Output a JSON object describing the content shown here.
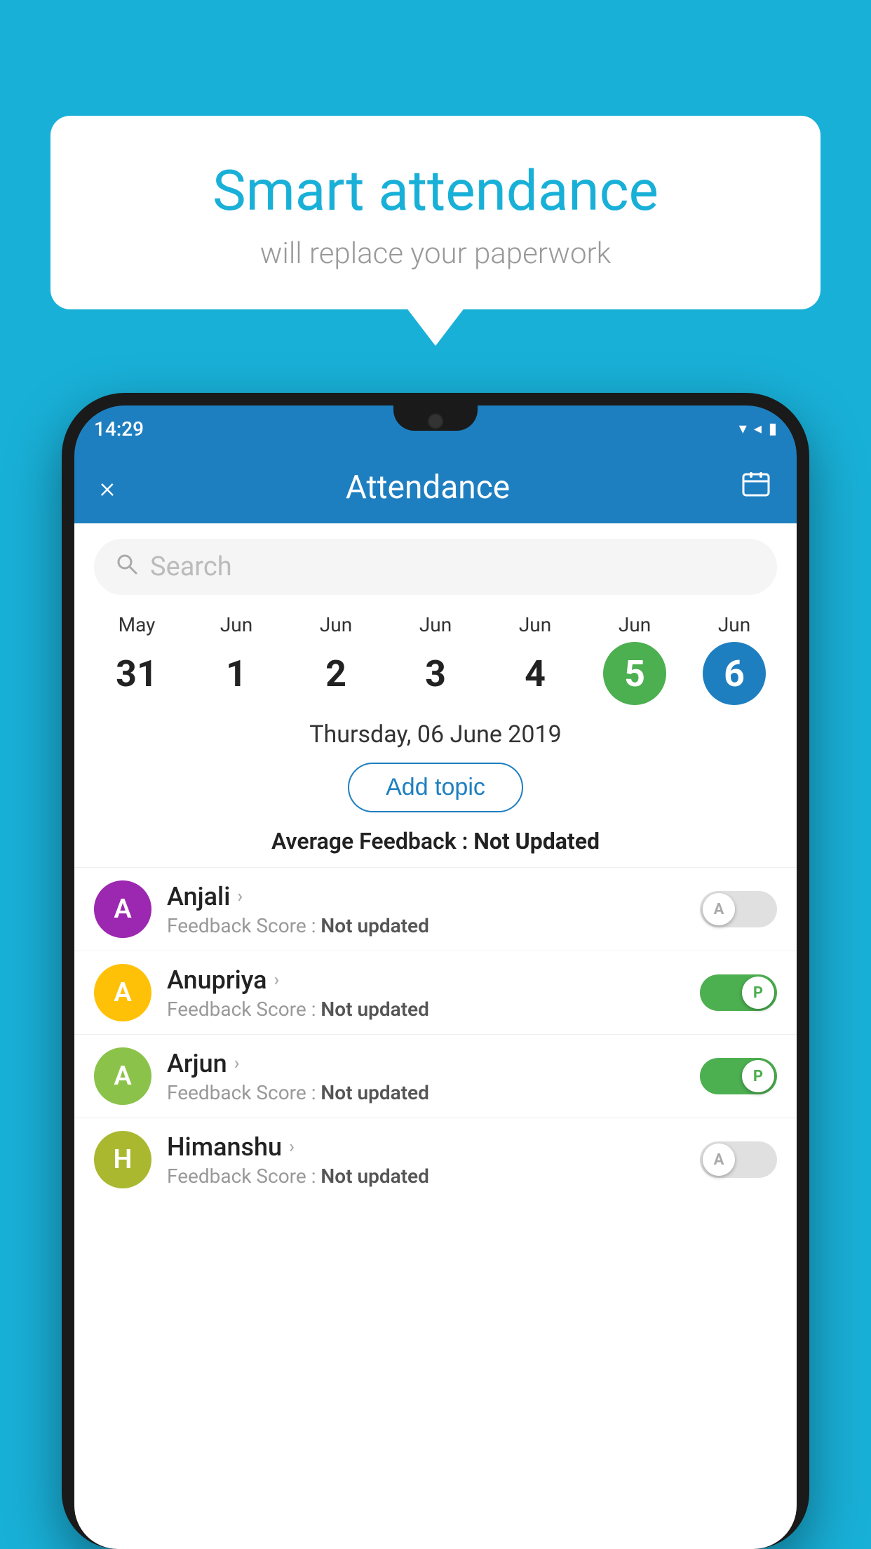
{
  "background_color": "#19b0d8",
  "bubble": {
    "title": "Smart attendance",
    "subtitle": "will replace your paperwork"
  },
  "phone": {
    "status_bar": {
      "time": "14:29",
      "wifi_icon": "wifi",
      "signal_icon": "signal",
      "battery_icon": "battery"
    },
    "header": {
      "close_icon": "×",
      "title": "Attendance",
      "calendar_icon": "📅"
    },
    "search": {
      "placeholder": "Search"
    },
    "dates": [
      {
        "month": "May",
        "day": "31",
        "selected": false
      },
      {
        "month": "Jun",
        "day": "1",
        "selected": false
      },
      {
        "month": "Jun",
        "day": "2",
        "selected": false
      },
      {
        "month": "Jun",
        "day": "3",
        "selected": false
      },
      {
        "month": "Jun",
        "day": "4",
        "selected": false
      },
      {
        "month": "Jun",
        "day": "5",
        "selected": "green"
      },
      {
        "month": "Jun",
        "day": "6",
        "selected": "blue"
      }
    ],
    "selected_date_label": "Thursday, 06 June 2019",
    "add_topic_label": "Add topic",
    "avg_feedback_label": "Average Feedback :",
    "avg_feedback_value": "Not Updated",
    "students": [
      {
        "name": "Anjali",
        "avatar_letter": "A",
        "avatar_color": "purple",
        "feedback": "Not updated",
        "toggle_state": "off",
        "toggle_letter": "A"
      },
      {
        "name": "Anupriya",
        "avatar_letter": "A",
        "avatar_color": "yellow",
        "feedback": "Not updated",
        "toggle_state": "on",
        "toggle_letter": "P"
      },
      {
        "name": "Arjun",
        "avatar_letter": "A",
        "avatar_color": "green",
        "feedback": "Not updated",
        "toggle_state": "on",
        "toggle_letter": "P"
      },
      {
        "name": "Himanshu",
        "avatar_letter": "H",
        "avatar_color": "olive",
        "feedback": "Not updated",
        "toggle_state": "off",
        "toggle_letter": "A"
      }
    ]
  }
}
